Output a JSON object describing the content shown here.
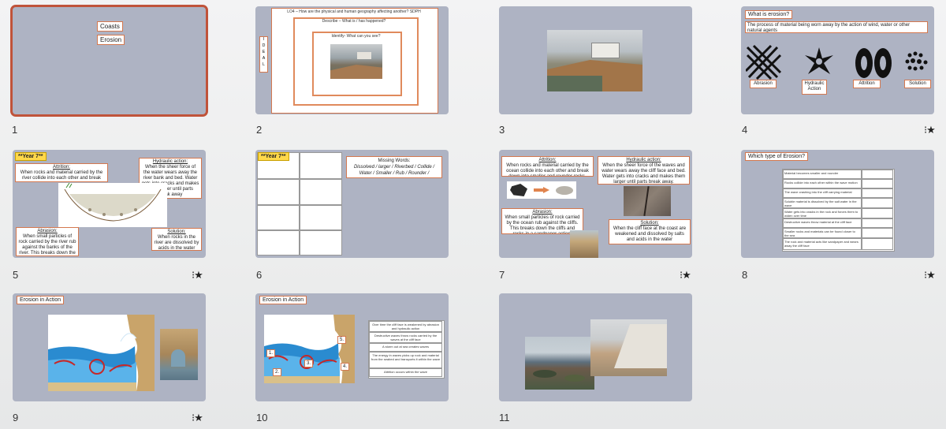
{
  "slides": [
    {
      "num": "1",
      "texts": [
        "Coasts",
        "Erosion"
      ]
    },
    {
      "num": "2",
      "texts": [
        "LO4 – How are the physical and human geography affecting another? SDPH",
        "Describe – What is / has happened?",
        "Identify- What can you see?",
        "I",
        "D",
        "E",
        "A",
        "L"
      ]
    },
    {
      "num": "3"
    },
    {
      "num": "4",
      "texts": [
        "What is erosion?",
        "The process of material being worn away by the action of wind, water or other natural agents",
        "Abrasion",
        "Hydraulic Action",
        "Attrition",
        "Solution"
      ]
    },
    {
      "num": "5",
      "texts": [
        "**Year 7**",
        "Attrition:",
        "When rocks and material carried by the river collide into each other and break down into smaller and rounder rocks.",
        "Hydraulic action:",
        "When the sheer force of the water wears away the river bank and bed. Water gets into cracks and makes them larger until parts break away",
        "Abrasion:",
        "When small particles of rock carried by the river rub against the banks of the river. This breaks down the river bed in a sand paper action.",
        "Solution:",
        "When rocks in the river are dissolved by acids in the water"
      ]
    },
    {
      "num": "6",
      "texts": [
        "**Year 7**",
        "Missing Words:",
        "Dissolved / larger / Riverbed / Collide / Water / Smaller / Rub / Rounder / Sandpaper / Rocks"
      ]
    },
    {
      "num": "7",
      "texts": [
        "Attrition:",
        "When rocks and material carried by the ocean collide into each other and break down into smaller and rounder rocks.",
        "Hydraulic action:",
        "When the sheer force of the waves and water wears away the cliff face and bed. Water gets into cracks and makes them larger until parts break away.",
        "Abrasion:",
        "When small particles of rock carried by the ocean rub against the cliffs. This breaks down the cliffs and rocks in a sandpaper action.",
        "Solution:",
        "When the cliff face at the coast are weakened and dissolved by salts and acids in the water"
      ]
    },
    {
      "num": "8",
      "texts": [
        "Which type of Erosion?",
        "Material becomes smaller and rounder",
        "Rocks collide into each other within the wave motion",
        "The wave crashing into the cliff carrying material",
        "Soluble material is dissolved by the salt water in the wave",
        "Water gets into cracks in the rock and forces them to widen over time",
        "Destructive waves throw material at the cliff face",
        "Smaller rocks and materials can be found closer to the sea",
        "The rock and material acts like sandpaper and wears away the cliff face"
      ]
    },
    {
      "num": "9",
      "texts": [
        "Erosion in Action"
      ]
    },
    {
      "num": "10",
      "texts": [
        "Erosion in Action",
        "Over time the cliff face is weakened by abrasion and hydraulic action",
        "Destructive waves throw rocks carried by the waves at the cliff face",
        "A storm out at sea creates waves",
        "The energy in waves picks up rock and material from the seabed and transports it within the wave",
        "Attrition occurs within the wave",
        "1.",
        "2.",
        "3.",
        "4.",
        "5."
      ]
    },
    {
      "num": "11"
    }
  ],
  "star_glyph": "⁝★",
  "colors": {
    "slide_bg": "#aeb3c3",
    "accent": "#c0533a",
    "label_border": "#d4784f"
  }
}
